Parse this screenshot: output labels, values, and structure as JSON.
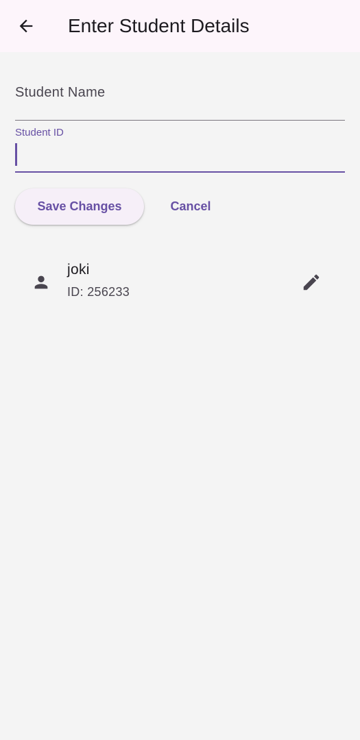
{
  "app_bar": {
    "title": "Enter Student Details",
    "back_icon": "arrow-back-icon"
  },
  "form": {
    "student_name": {
      "label": "Student Name",
      "value": ""
    },
    "student_id": {
      "label": "Student ID",
      "value": ""
    },
    "save_label": "Save Changes",
    "cancel_label": "Cancel"
  },
  "students": [
    {
      "name": "joki",
      "id_text": "ID: 256233",
      "leading_icon": "person-icon",
      "trailing_icon": "edit-icon"
    }
  ],
  "colors": {
    "primary": "#6750a4",
    "background": "#f4f4f4",
    "app_bar_background": "#fdf5fb",
    "button_background": "#f6eff8",
    "underline": "#79747e",
    "icon": "#49454f"
  }
}
